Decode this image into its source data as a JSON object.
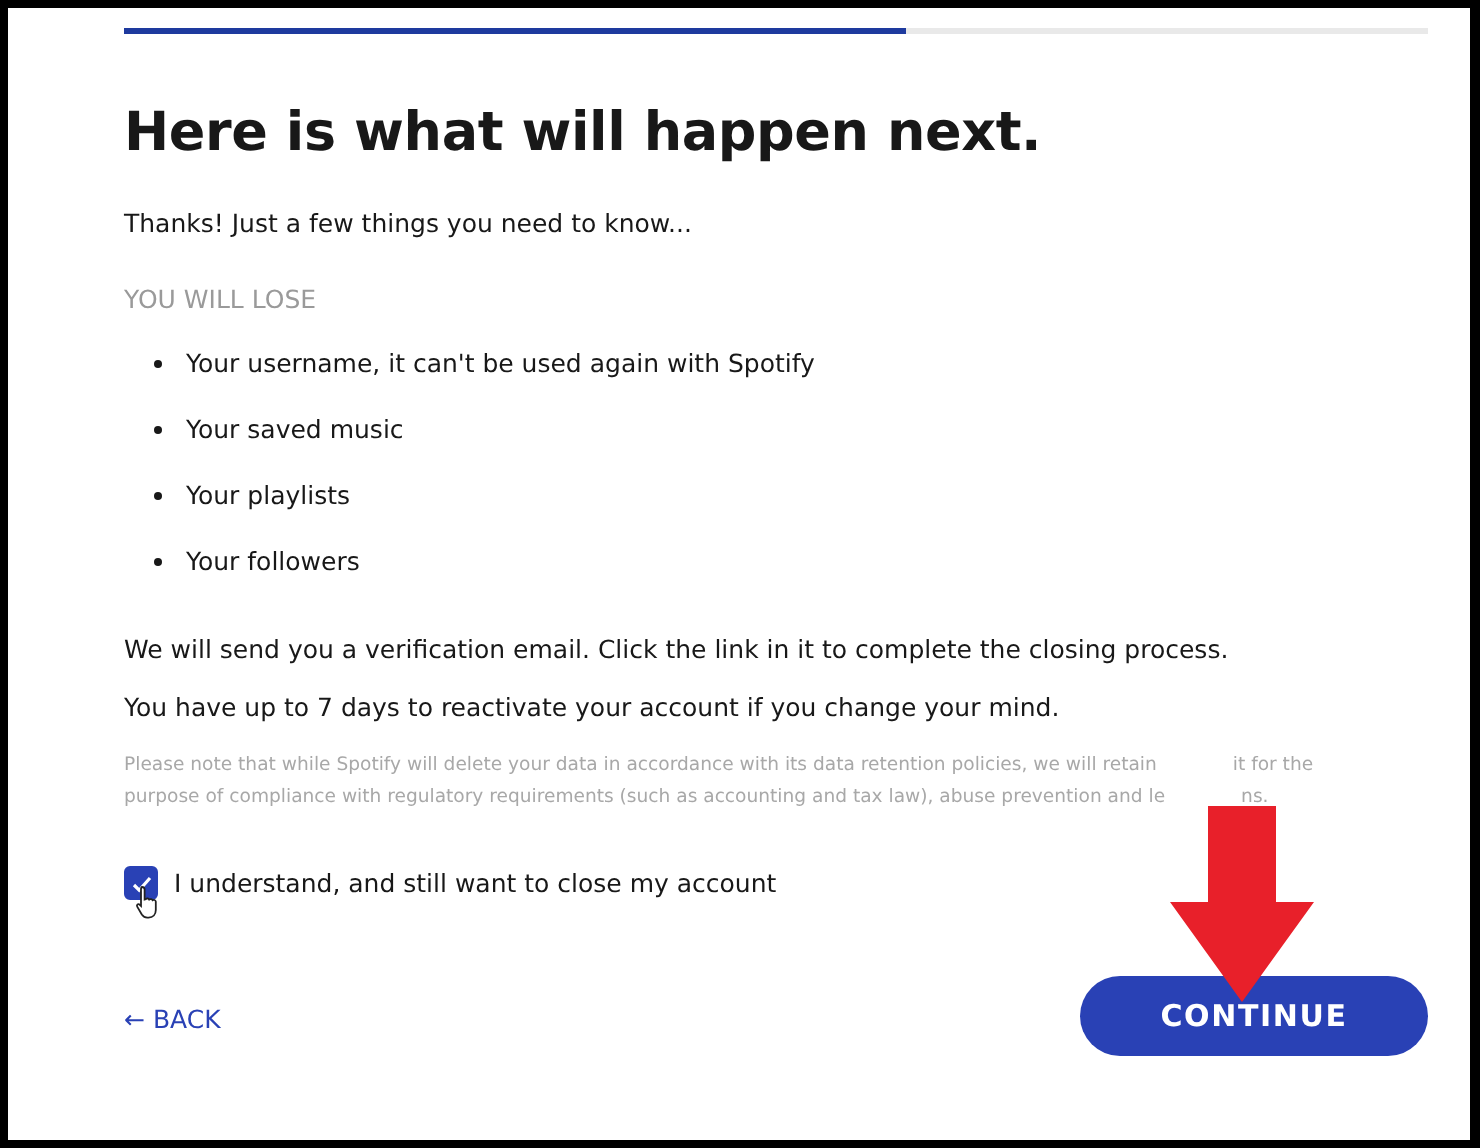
{
  "progress": {
    "level": 0.6
  },
  "heading": "Here is what will happen next.",
  "intro": "Thanks! Just a few things you need to know...",
  "lose_section": {
    "title": "YOU WILL LOSE",
    "items": [
      "Your username, it can't be used again with Spotify",
      "Your saved music",
      "Your playlists",
      "Your followers"
    ]
  },
  "paragraphs": [
    "We will send you a verification email. Click the link in it to complete the closing process.",
    "You have up to 7 days to reactivate your account if you change your mind."
  ],
  "note_lines": [
    {
      "before": "Please note that while Spotify will delete your data in accordance with its data retention policies, we will retain",
      "after": "it for the"
    },
    {
      "before": "purpose of compliance with regulatory requirements (such as accounting and tax law), abuse prevention and le",
      "after": "ns."
    }
  ],
  "confirm": {
    "label": "I understand, and still want to close my account",
    "checked": true
  },
  "back_link": "← BACK",
  "continue_button": "CONTINUE"
}
